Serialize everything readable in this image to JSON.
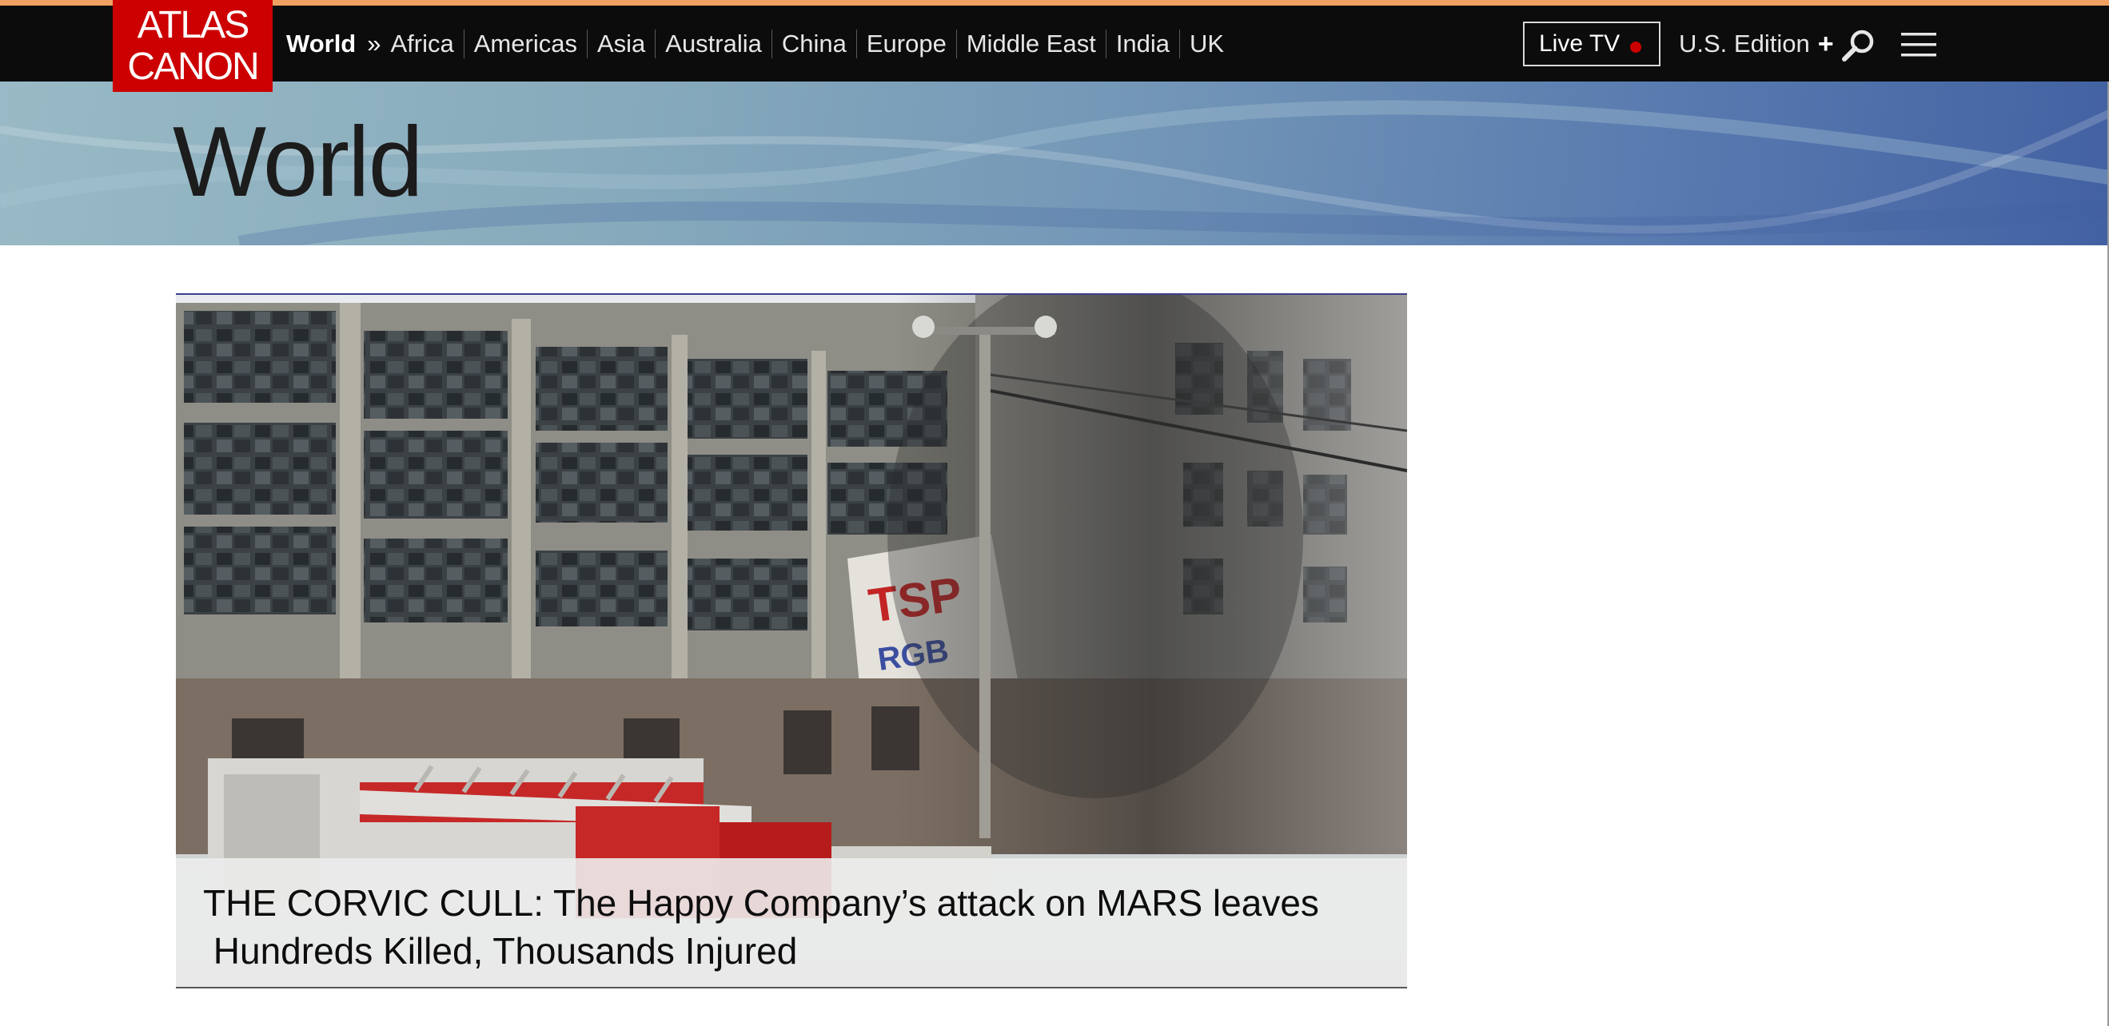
{
  "brand": {
    "logo_line1": "ATLAS",
    "logo_line2": "CANON",
    "color": "#cc0000"
  },
  "nav": {
    "current_section": "World",
    "separator": "»",
    "items": [
      "Africa",
      "Americas",
      "Asia",
      "Australia",
      "China",
      "Europe",
      "Middle East",
      "India",
      "UK"
    ]
  },
  "header_actions": {
    "live_tv_label": "Live TV",
    "edition_label": "U.S. Edition",
    "edition_plus": "+",
    "search_icon": "search-icon",
    "menu_icon": "hamburger-menu-icon"
  },
  "page": {
    "title": "World"
  },
  "lead_story": {
    "image_icon": "burning-factory-with-fire-truck-image",
    "headline_line1": "THE CORVIC CULL: The Happy Company’s attack on MARS leaves",
    "headline_line2": " Hundreds Killed, Thousands Injured"
  },
  "colors": {
    "topbar": "#0c0c0c",
    "accent_stripe": "#f0a162",
    "live_dot": "#cc0000"
  }
}
